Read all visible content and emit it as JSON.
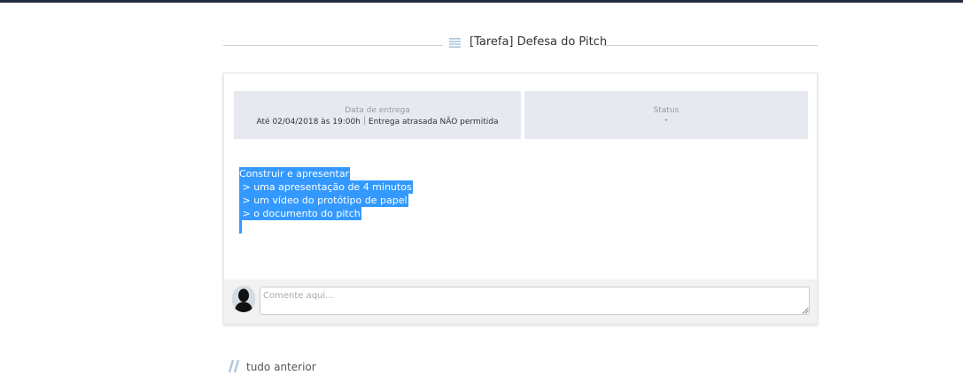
{
  "header": {
    "title": "[Tarefa] Defesa do Pitch",
    "icon": "list-icon"
  },
  "info": {
    "due_label": "Data de entrega",
    "due_value": "Até 02/04/2018 às 19:00h",
    "late_value": "Entrega atrasada NÃO permitida",
    "status_label": "Status",
    "status_value": "-"
  },
  "description": {
    "lines": [
      "Construir e apresentar",
      " > uma apresentação de 4 minutos",
      " > um vídeo do protótipo de papel",
      " > o documento do pitch"
    ]
  },
  "comment": {
    "placeholder": "Comente aqui...",
    "avatar_icon": "user-silhouette-icon"
  },
  "footer": {
    "text": "tudo anterior"
  },
  "colors": {
    "selection": "#3399ff",
    "info_bg": "#e6e9ef",
    "topbar": "#1f2d3d"
  }
}
